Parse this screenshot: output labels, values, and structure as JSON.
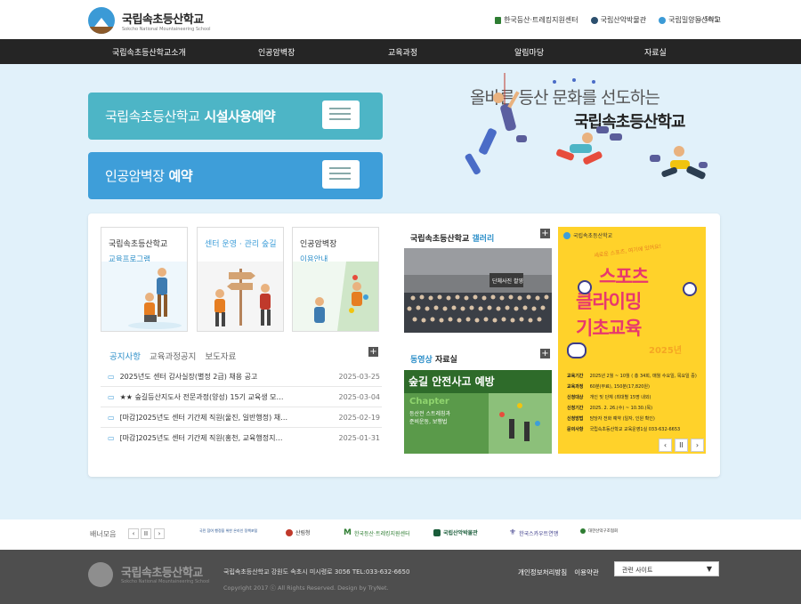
{
  "header": {
    "logo_title": "국립속초등산학교",
    "logo_sub": "Sokcho National Mountaineering School",
    "links": [
      "한국등산·트레킹지원센터",
      "국립산악박물관",
      "국립밀양등산학교"
    ],
    "sns": "SNS"
  },
  "nav": [
    "국립속초등산학교소개",
    "인공암벽장",
    "교육과정",
    "알림마당",
    "자료실"
  ],
  "hero": {
    "btn1_a": "국립속초등산학교",
    "btn1_b": "시설사용예약",
    "btn2_a": "인공암벽장",
    "btn2_b": "예약",
    "slogan1": "올바른 등산 문화를 선도하는",
    "slogan2": "국립속초등산학교",
    "accent_blue": "#3e9ed9",
    "accent_teal": "#4db5c6"
  },
  "cards": [
    {
      "t1": "국립속초등산학교",
      "t2": "교육프로그램"
    },
    {
      "t1": "센터 운영 · 관리 숲길",
      "t2": ""
    },
    {
      "t1": "인공암벽장",
      "t2": "이용안내"
    }
  ],
  "notices": {
    "tabs": [
      "공지사항",
      "교육과정공지",
      "보도자료"
    ],
    "rows": [
      {
        "title": "2025년도 센터 감사실장(별정 2급) 채용 공고",
        "date": "2025-03-25"
      },
      {
        "title": "★★ 숲길등산지도사 전문과정(양성) 15기 교육생 모…",
        "date": "2025-03-04"
      },
      {
        "title": "[마감]2025년도 센터 기간제 직원(울진, 일반행정) 채…",
        "date": "2025-02-19"
      },
      {
        "title": "[마감]2025년도 센터 기간제 직원(홍천, 교육행정지…",
        "date": "2025-01-31"
      }
    ]
  },
  "gallery": {
    "title_a": "국립속초등산학교",
    "title_b": "갤러리",
    "photo_caption": "단체사진 촬영"
  },
  "video": {
    "title_a": "동영상",
    "title_b": "자료실",
    "thumb_title": "숲길 안전사고 예방",
    "thumb_chapter": "Chapter",
    "thumb_sub1": "등산전 스트레칭과",
    "thumb_sub2": "준비운동, 보행법"
  },
  "poster": {
    "brand": "국립속초등산학교",
    "bubble": "새로운 스포츠, 여기에 있어요!",
    "line1": "스포츠",
    "line2": "클라이밍",
    "line3": "기초교육",
    "year": "2025년",
    "rows": [
      {
        "k": "교육기간",
        "v": "2025년 2월 ~ 10월 ( 총 34회, 매월 수요일, 목요일 중)"
      },
      {
        "k": "교육과정",
        "v": "60분(무료), 150분(17,820원)"
      },
      {
        "k": "신청대상",
        "v": "개인 및 단체 (최대별 15명 내외)"
      },
      {
        "k": "신청기간",
        "v": "2025. 2. 26.(수) ~ 10.30.(목)"
      },
      {
        "k": "신청방법",
        "v": "담당자 전화 예약 (일자, 인원 확인)"
      },
      {
        "k": "문의사항",
        "v": "국립속초등산학교 교육운영1실 033-632-6653"
      }
    ],
    "controls": [
      "‹",
      "II",
      "›"
    ]
  },
  "banner": {
    "title": "배너모음",
    "controls": [
      "‹",
      "II",
      "›"
    ],
    "logos": [
      "국민 참여 행정을 위한 온라인 정책포털",
      "산림청",
      "한국등산·트레킹지원센터",
      "국립산악박물관",
      "한국스카우트연맹",
      "대한산악구조협회"
    ]
  },
  "footer": {
    "logo_title": "국립속초등산학교",
    "logo_sub": "Sokcho National Mountaineering School",
    "address": "국립속초등산학교 강원도 속초시 미시령로 3056 TEL:033-632-6650",
    "copyright": "Copyright 2017 ⓒ All Rights Reserved. Design by TryNet.",
    "links": [
      "개인정보처리방침",
      "이용약관"
    ],
    "select": "관련 사이트"
  }
}
